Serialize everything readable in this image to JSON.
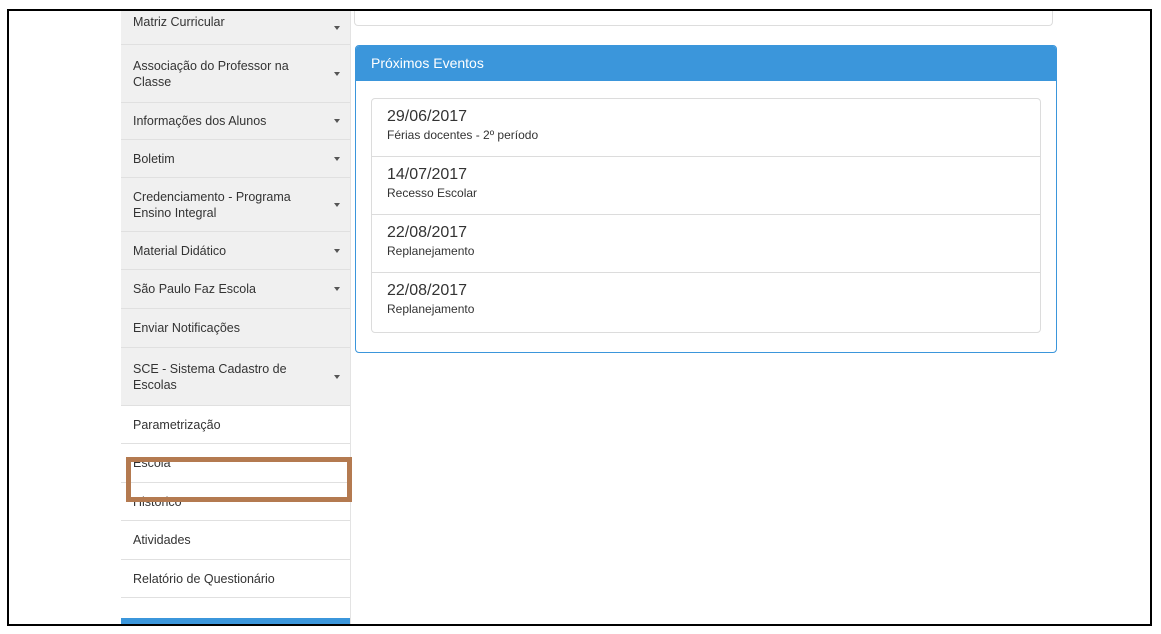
{
  "sidebar": {
    "items": [
      {
        "label": "Matriz Curricular",
        "dropdown": true
      },
      {
        "label": "Associação do Professor na Classe",
        "dropdown": true
      },
      {
        "label": "Informações dos Alunos",
        "dropdown": true
      },
      {
        "label": "Boletim",
        "dropdown": true
      },
      {
        "label": "Credenciamento - Programa Ensino Integral",
        "dropdown": true
      },
      {
        "label": "Material Didático",
        "dropdown": true
      },
      {
        "label": "São Paulo Faz Escola",
        "dropdown": true
      },
      {
        "label": "Enviar Notificações",
        "dropdown": false
      },
      {
        "label": "SCE - Sistema Cadastro de Escolas",
        "dropdown": true
      },
      {
        "label": "Parametrização",
        "dropdown": false
      },
      {
        "label": "Escola",
        "dropdown": false,
        "highlighted": true
      },
      {
        "label": "Historico",
        "dropdown": false
      },
      {
        "label": "Atividades",
        "dropdown": false
      },
      {
        "label": "Relatório de Questionário",
        "dropdown": false
      }
    ]
  },
  "events_panel": {
    "title": "Próximos Eventos",
    "events": [
      {
        "date": "29/06/2017",
        "description": "Férias docentes - 2º período"
      },
      {
        "date": "14/07/2017",
        "description": "Recesso Escolar"
      },
      {
        "date": "22/08/2017",
        "description": "Replanejamento"
      },
      {
        "date": "22/08/2017",
        "description": "Replanejamento"
      }
    ]
  },
  "colors": {
    "accent": "#3b96db",
    "highlight_border": "#b47a50",
    "submenu_bg": "#f0f0f0"
  }
}
